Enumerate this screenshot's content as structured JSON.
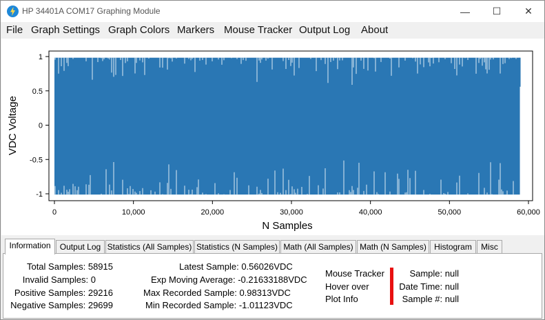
{
  "window": {
    "title": "HP 34401A COM17 Graphing Module",
    "controls": {
      "minimize": "—",
      "maximize": "☐",
      "close": "✕"
    }
  },
  "menu": [
    "File",
    "Graph Settings",
    "Graph Colors",
    "Markers",
    "Mouse Tracker",
    "Output Log",
    "About"
  ],
  "chart_data": {
    "type": "line",
    "xlabel": "N Samples",
    "ylabel": "VDC Voltage",
    "xlim": [
      0,
      60000
    ],
    "ylim": [
      -1.1,
      1.05
    ],
    "x_ticks": [
      "0",
      "10,000",
      "20,000",
      "30,000",
      "40,000",
      "50,000",
      "60,000"
    ],
    "y_ticks": [
      "1",
      "0.5",
      "0",
      "-0.5",
      "-1"
    ],
    "series": [
      {
        "color": "#2a77b4",
        "sample_count": 58915,
        "max": 0.98313,
        "min": -1.01123,
        "last": 0.56026
      }
    ],
    "grid": false,
    "legend": "none"
  },
  "tabs": [
    "Information",
    "Output Log",
    "Statistics (All Samples)",
    "Statistics (N Samples)",
    "Math (All Samples)",
    "Math (N Samples)",
    "Histogram",
    "Misc"
  ],
  "active_tab": "Information",
  "info": {
    "total_samples": "Total Samples: 58915",
    "invalid_samples": "Invalid Samples: 0",
    "positive_samples": "Positive Samples: 29216",
    "negative_samples": "Negative Samples: 29699",
    "latest_sample": "Latest Sample: 0.56026VDC",
    "exp_moving_average": "Exp Moving Average: -0.21633188VDC",
    "max_recorded": "Max Recorded Sample: 0.98313VDC",
    "min_recorded": "Min Recorded Sample: -1.01123VDC"
  },
  "mouse_tracker": {
    "label_lines": [
      "Mouse Tracker",
      "Hover over",
      "Plot Info"
    ],
    "sample": "Sample: null",
    "date_time": "Date Time: null",
    "sample_number": "Sample #: null",
    "bar_color": "#e81010"
  }
}
